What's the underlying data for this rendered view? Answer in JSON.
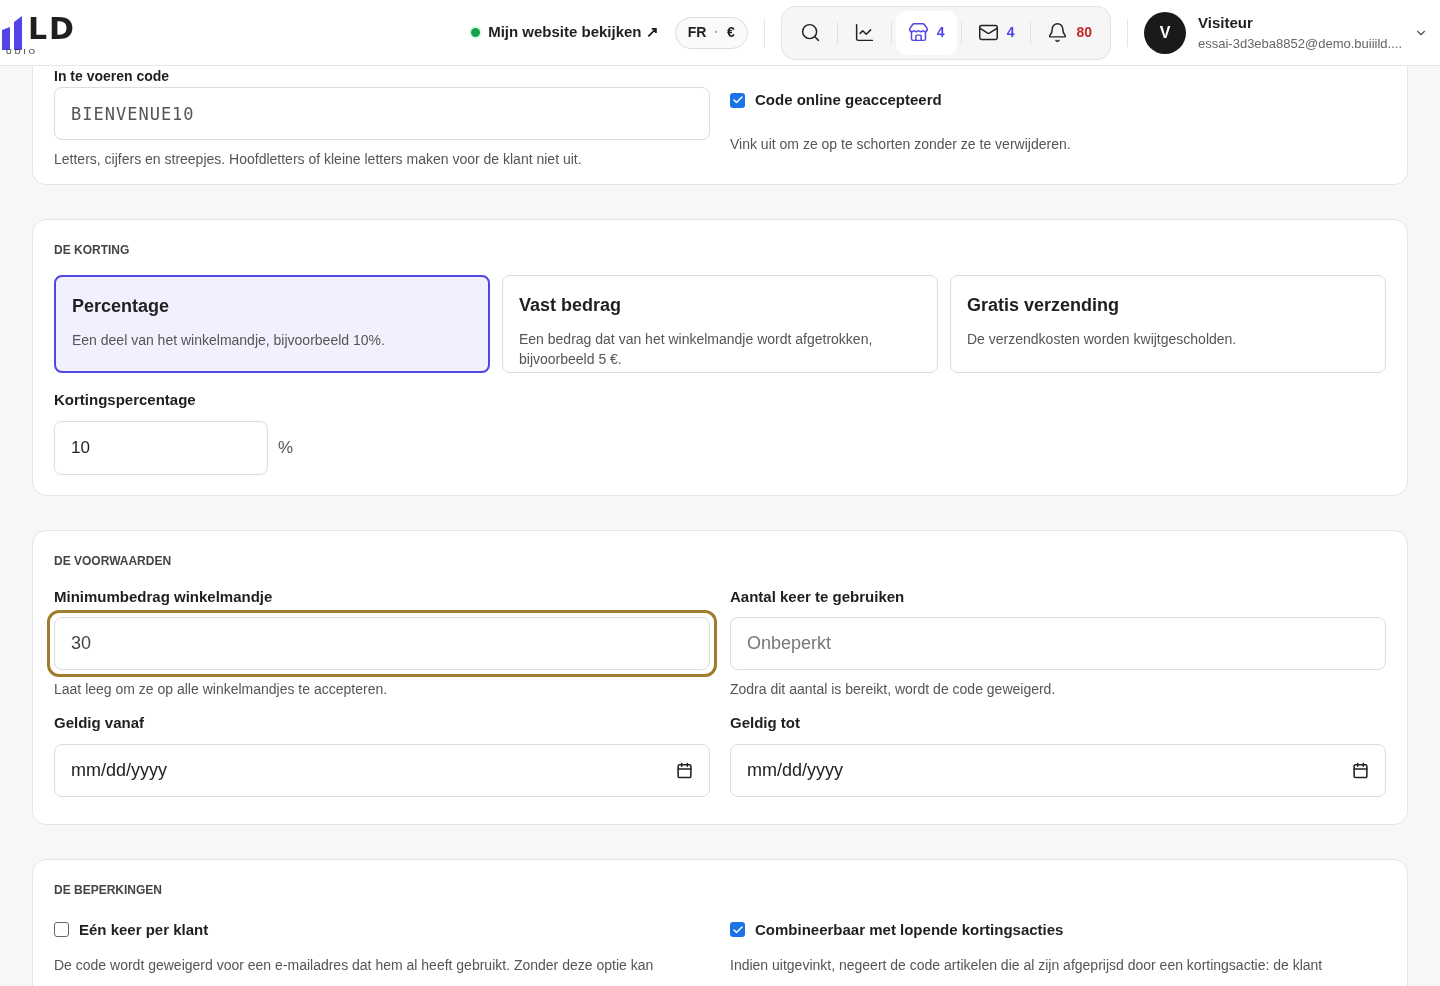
{
  "header": {
    "logo_mark": "LD",
    "logo_sub": "UDIO",
    "site_link": "Mijn website bekijken ↗",
    "site_online": true,
    "locale": "FR",
    "locale_separator": "·",
    "currency": "€",
    "toolbar": [
      {
        "kind": "search",
        "selected": false
      },
      {
        "kind": "chart",
        "selected": false
      },
      {
        "kind": "store",
        "count": "4",
        "selected": true
      },
      {
        "kind": "mail",
        "count": "4",
        "selected": false
      },
      {
        "kind": "bell",
        "count": "80",
        "selected": false
      }
    ],
    "user": {
      "initial": "V",
      "name": "Visiteur",
      "email": "essai-3d3eba8852@demo.buiiild...."
    }
  },
  "code_card": {
    "label": "In te voeren code",
    "value": "BIENVENUE10",
    "hint": "Letters, cijfers en streepjes. Hoofdletters of kleine letters maken voor de klant niet uit.",
    "online": {
      "label": "Code online geaccepteerd",
      "checked": true,
      "hint": "Vink uit om ze op te schorten zonder ze te verwijderen."
    }
  },
  "discount": {
    "title": "DE KORTING",
    "options": [
      {
        "title": "Percentage",
        "desc": "Een deel van het winkelmandje, bijvoorbeeld 10%.",
        "selected": true
      },
      {
        "title": "Vast bedrag",
        "desc": "Een bedrag dat van het winkelmandje wordt afgetrokken, bijvoorbeeld 5 €.",
        "selected": false
      },
      {
        "title": "Gratis verzending",
        "desc": "De verzendkosten worden kwijtgescholden.",
        "selected": false
      }
    ],
    "field_label": "Kortingspercentage",
    "value": "10",
    "unit": "%"
  },
  "conditions": {
    "title": "DE VOORWAARDEN",
    "fields": [
      {
        "label": "Minimumbedrag winkelmandje",
        "value": "30",
        "hint": "Laat leeg om ze op alle winkelmandjes te accepteren.",
        "focused": true,
        "kind": "text"
      },
      {
        "label": "Aantal keer te gebruiken",
        "placeholder": "Onbeperkt",
        "hint": "Zodra dit aantal is bereikt, wordt de code geweigerd.",
        "focused": false,
        "kind": "text"
      },
      {
        "label": "Geldig vanaf",
        "placeholder": "mm/dd/yyyy",
        "focused": false,
        "kind": "date"
      },
      {
        "label": "Geldig tot",
        "placeholder": "mm/dd/yyyy",
        "focused": false,
        "kind": "date"
      }
    ]
  },
  "restrictions": {
    "title": "DE BEPERKINGEN",
    "options": [
      {
        "label": "Eén keer per klant",
        "checked": false,
        "hint": "De code wordt geweigerd voor een e-mailadres dat hem al heeft gebruikt. Zonder deze optie kan"
      },
      {
        "label": "Combineerbaar met lopende kortingsacties",
        "checked": true,
        "hint": "Indien uitgevinkt, negeert de code artikelen die al zijn afgeprijsd door een kortingsactie: de klant"
      }
    ]
  }
}
